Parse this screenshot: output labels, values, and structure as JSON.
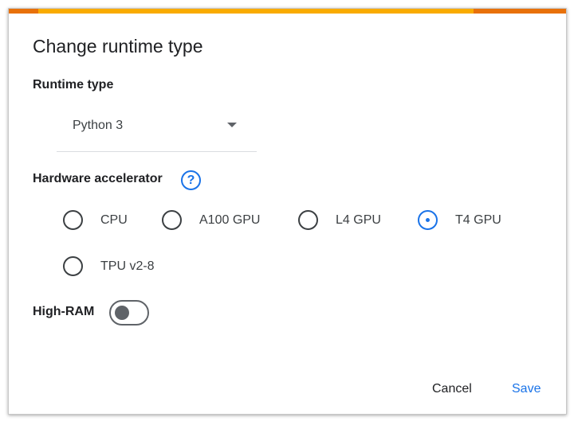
{
  "dialog": {
    "title": "Change runtime type",
    "runtime_label": "Runtime type",
    "runtime_value": "Python 3",
    "hardware_label": "Hardware accelerator",
    "help_glyph": "?",
    "accelerators": [
      {
        "label": "CPU",
        "selected": false
      },
      {
        "label": "A100 GPU",
        "selected": false
      },
      {
        "label": "L4 GPU",
        "selected": false
      },
      {
        "label": "T4 GPU",
        "selected": true
      },
      {
        "label": "TPU v2-8",
        "selected": false
      }
    ],
    "high_ram_label": "High-RAM",
    "high_ram_on": false,
    "cancel_label": "Cancel",
    "save_label": "Save"
  },
  "colors": {
    "accent": "#1a73e8",
    "bar_orange": "#e8710a",
    "bar_yellow": "#f9ab00"
  },
  "icons": {
    "help": "help-circle-icon",
    "dropdown": "dropdown-arrow-icon"
  }
}
